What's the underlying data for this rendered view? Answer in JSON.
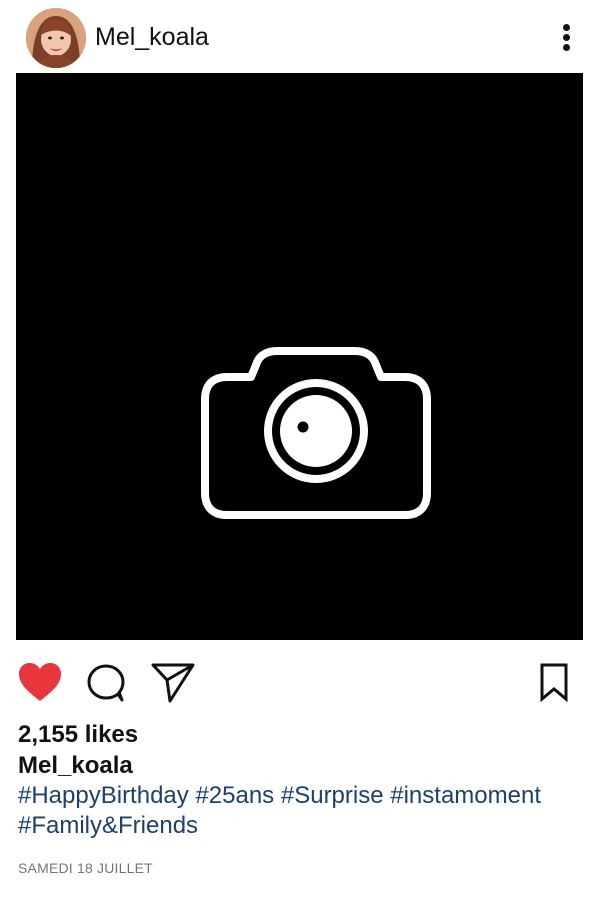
{
  "post": {
    "username": "Mel_koala",
    "likes_text": "2,155 likes",
    "caption_username": "Mel_koala",
    "hashtags_line1": [
      "#HappyBirthday",
      "#25ans",
      "#Surprise",
      "#instamoment"
    ],
    "hashtags_line2": [
      "#Family&Friends"
    ],
    "date": "SAMEDI 18 JUILLET",
    "liked": true
  },
  "icons": {
    "more": "more-vertical-icon",
    "photo": "camera-icon",
    "like": "heart-icon",
    "comment": "comment-icon",
    "share": "send-icon",
    "save": "bookmark-icon"
  },
  "colors": {
    "like": "#e8363b",
    "hashtag": "#1d3f72",
    "photo_background": "#000000",
    "date": "#757575"
  }
}
